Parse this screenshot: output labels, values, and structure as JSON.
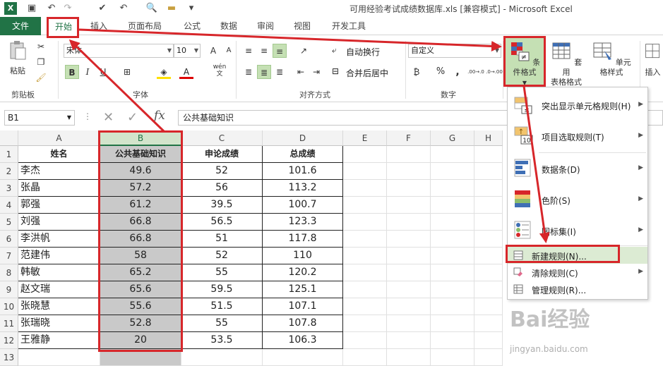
{
  "window": {
    "title": "可用经验考试成绩数据库.xls  [兼容模式] - Microsoft Excel"
  },
  "tabs": [
    "文件",
    "开始",
    "插入",
    "页面布局",
    "公式",
    "数据",
    "审阅",
    "视图",
    "开发工具"
  ],
  "ribbon": {
    "clipboard": {
      "paste": "粘贴",
      "label": "剪贴板"
    },
    "font": {
      "name": "宋体",
      "size": "10",
      "label": "字体",
      "bold": "B",
      "italic": "I",
      "underline": "U",
      "phonetic": "wén",
      "phonetic_small": "文"
    },
    "alignment": {
      "wrap": "自动换行",
      "merge": "合并后居中",
      "label": "对齐方式"
    },
    "number": {
      "format": "自定义",
      "percent": "%",
      "comma": ",",
      "inc_decimal": ".00→.0",
      "dec_decimal": ".0→.00",
      "label": "数字"
    },
    "styles": {
      "conditional": "条件格式",
      "table_line1": "套用",
      "table_line2": "表格格式",
      "cell_styles": "单元格样式"
    },
    "cells": {
      "insert": "插入"
    }
  },
  "formula_bar": {
    "name_box": "B1",
    "fx": "fx",
    "value": "公共基础知识"
  },
  "columns": [
    "A",
    "B",
    "C",
    "D",
    "E",
    "F",
    "G",
    "H"
  ],
  "rows": [
    "1",
    "2",
    "3",
    "4",
    "5",
    "6",
    "7",
    "8",
    "9",
    "10",
    "11",
    "12",
    "13"
  ],
  "table": {
    "headers": [
      "姓名",
      "公共基础知识",
      "申论成绩",
      "总成绩"
    ],
    "data": [
      [
        "李杰",
        "49.6",
        "52",
        "101.6"
      ],
      [
        "张晶",
        "57.2",
        "56",
        "113.2"
      ],
      [
        "郭强",
        "61.2",
        "39.5",
        "100.7"
      ],
      [
        "刘强",
        "66.8",
        "56.5",
        "123.3"
      ],
      [
        "李洪帆",
        "66.8",
        "51",
        "117.8"
      ],
      [
        "范建伟",
        "58",
        "52",
        "110"
      ],
      [
        "韩敏",
        "65.2",
        "55",
        "120.2"
      ],
      [
        "赵文瑞",
        "65.6",
        "59.5",
        "125.1"
      ],
      [
        "张晓慧",
        "55.6",
        "51.5",
        "107.1"
      ],
      [
        "张瑞晓",
        "52.8",
        "55",
        "107.8"
      ],
      [
        "王雅静",
        "20",
        "53.5",
        "106.3"
      ]
    ]
  },
  "menu": {
    "items": [
      "突出显示单元格规则(H)",
      "项目选取规则(T)",
      "数据条(D)",
      "色阶(S)",
      "图标集(I)",
      "新建规则(N)...",
      "清除规则(C)",
      "管理规则(R)..."
    ],
    "icon_numbers": [
      "10"
    ]
  },
  "watermark": {
    "main": "Bai经验",
    "sub": "jingyan.baidu.com"
  },
  "colors": {
    "excel_green": "#217346",
    "highlight_red": "#d7262a",
    "selection_gray": "#c9c9c9"
  }
}
